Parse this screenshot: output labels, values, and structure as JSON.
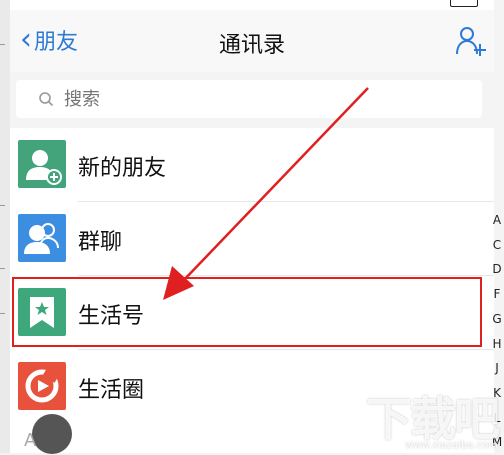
{
  "nav": {
    "back_label": "朋友",
    "title": "通讯录"
  },
  "search": {
    "placeholder": "搜索"
  },
  "items": [
    {
      "label": "新的朋友",
      "icon": "new-friend-icon",
      "color": "#43a47b"
    },
    {
      "label": "群聊",
      "icon": "group-chat-icon",
      "color": "#3b8ee0"
    },
    {
      "label": "生活号",
      "icon": "lifestyle-account-icon",
      "color": "#3fa77c"
    },
    {
      "label": "生活圈",
      "icon": "life-circle-icon",
      "color": "#e8523d"
    }
  ],
  "index_letters": [
    "A",
    "C",
    "D",
    "F",
    "G",
    "H",
    "J",
    "K",
    "L",
    "M"
  ],
  "bottom_letter": "A",
  "annotation": {
    "highlight_color": "#e02020"
  },
  "watermark": {
    "text": "下载吧",
    "url": "www.xiazaiba.com"
  }
}
